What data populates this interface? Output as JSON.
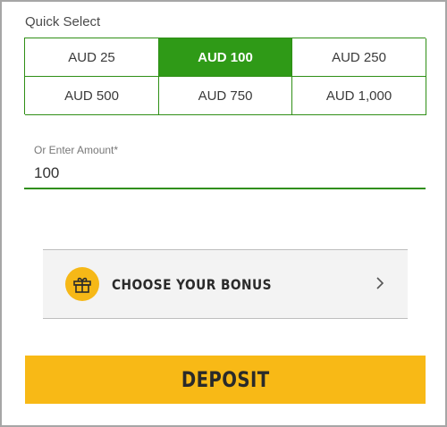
{
  "quick_select": {
    "label": "Quick Select",
    "options": [
      {
        "label": "AUD 25",
        "selected": false
      },
      {
        "label": "AUD 100",
        "selected": true
      },
      {
        "label": "AUD 250",
        "selected": false
      },
      {
        "label": "AUD 500",
        "selected": false
      },
      {
        "label": "AUD 750",
        "selected": false
      },
      {
        "label": "AUD 1,000",
        "selected": false
      }
    ]
  },
  "amount": {
    "label": "Or Enter Amount*",
    "value": "100"
  },
  "bonus": {
    "label": "CHOOSE YOUR BONUS",
    "icon": "gift-icon",
    "chevron_icon": "chevron-right-icon"
  },
  "deposit": {
    "label": "DEPOSIT"
  },
  "colors": {
    "selected_green": "#2f9a17",
    "border_green": "#2f8f16",
    "accent_yellow": "#f8b916",
    "frame_gray": "#a6a6a6"
  }
}
